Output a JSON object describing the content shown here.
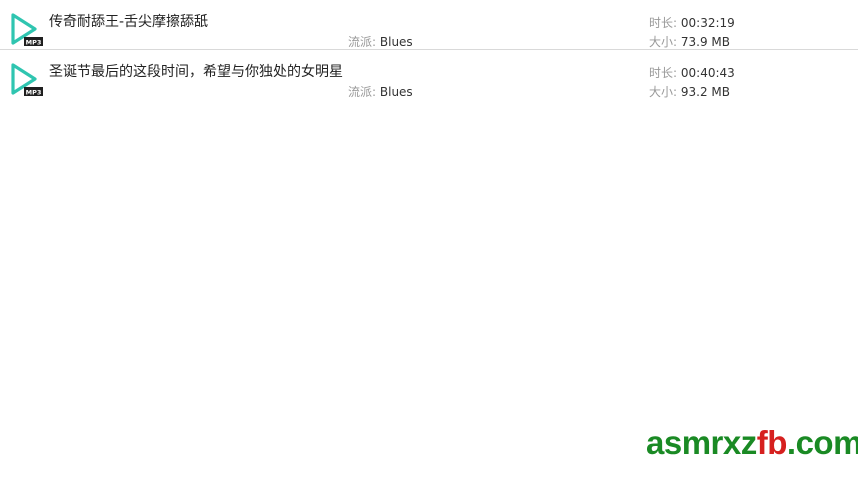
{
  "tracks": [
    {
      "title": "传奇耐舔王-舌尖摩擦舔舐",
      "genre_label": "流派:",
      "genre": "Blues",
      "duration_label": "时长:",
      "duration": "00:32:19",
      "size_label": "大小:",
      "size": "73.9 MB",
      "format_badge": "MP3",
      "icon": "mp3-play-icon"
    },
    {
      "title": "圣诞节最后的这段时间，希望与你独处的女明星",
      "genre_label": "流派:",
      "genre": "Blues",
      "duration_label": "时长:",
      "duration": "00:40:43",
      "size_label": "大小:",
      "size": "93.2 MB",
      "format_badge": "MP3",
      "icon": "mp3-play-icon"
    }
  ],
  "watermark": {
    "part1": "asmrxz",
    "part2": "fb",
    "part3": ".com"
  },
  "colors": {
    "icon_accent": "#2fc5b0",
    "watermark_green": "#1a8a24",
    "watermark_red": "#d6201f"
  }
}
